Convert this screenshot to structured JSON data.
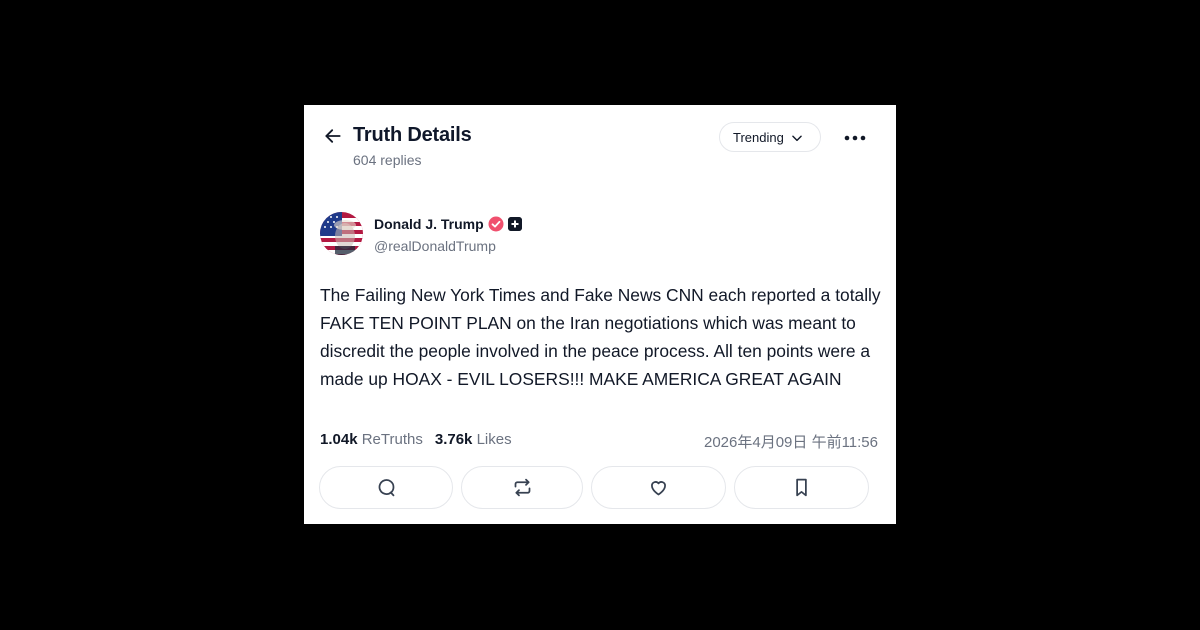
{
  "header": {
    "title": "Truth Details",
    "reply_count": "604 replies",
    "sort_label": "Trending",
    "back_icon": "arrow-left-icon",
    "more_icon": "ellipsis-icon"
  },
  "author": {
    "display_name": "Donald J. Trump",
    "handle": "@realDonaldTrump",
    "verified_icon": "verified-check-icon",
    "badge_icon": "plus-badge-icon",
    "verified_color": "#f0506e"
  },
  "post": {
    "text": "The Failing New York Times and Fake News CNN each reported a totally FAKE TEN POINT PLAN on the Iran negotiations which was meant to discredit the people involved in the peace process. All ten points were a made up HOAX - EVIL LOSERS!!! MAKE AMERICA GREAT AGAIN",
    "retruths_count": "1.04k",
    "retruths_label": "ReTruths",
    "likes_count": "3.76k",
    "likes_label": "Likes",
    "timestamp": "2026年4月09日 午前11:56"
  },
  "actions": [
    {
      "name": "reply",
      "icon": "comment-icon"
    },
    {
      "name": "retruth",
      "icon": "repost-icon"
    },
    {
      "name": "like",
      "icon": "heart-icon"
    },
    {
      "name": "bookmark",
      "icon": "bookmark-icon"
    }
  ]
}
